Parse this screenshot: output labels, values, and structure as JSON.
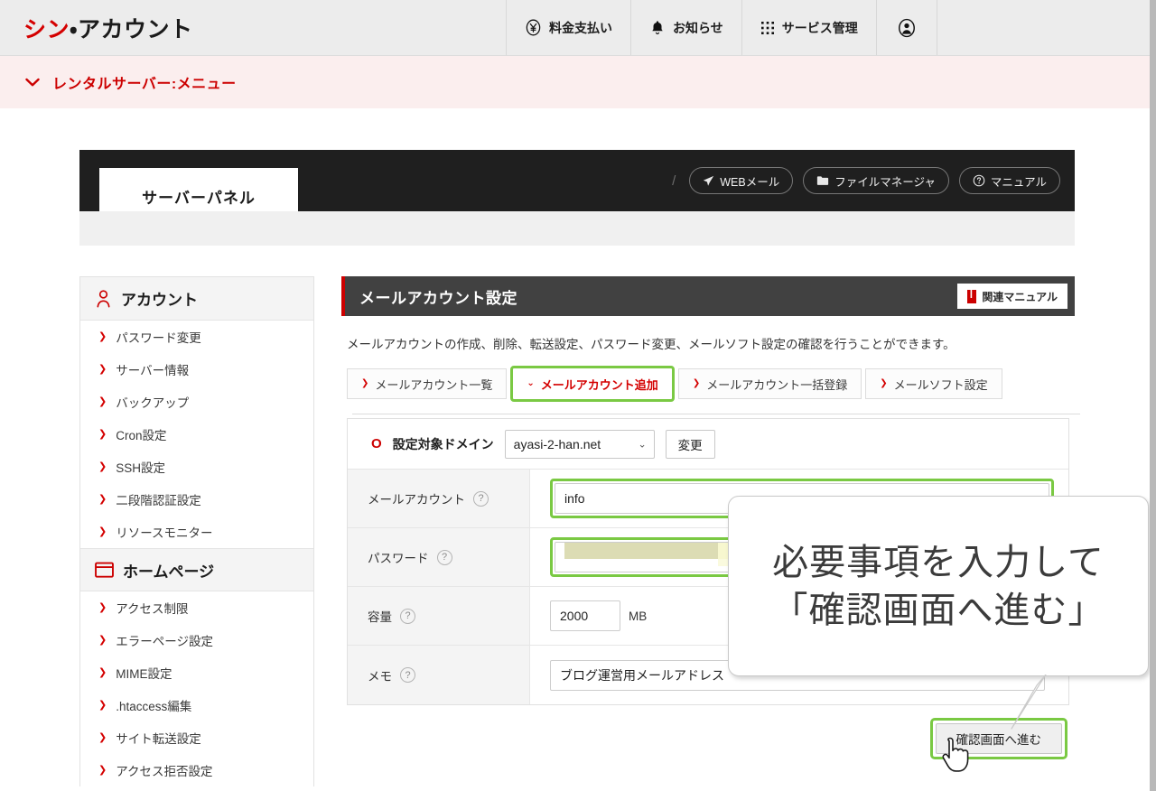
{
  "header": {
    "brand_red": "シン",
    "brand_dark": "・アカウント",
    "nav": [
      {
        "label": "料金支払い",
        "icon": "yen-circle-icon"
      },
      {
        "label": "お知らせ",
        "icon": "bell-icon"
      },
      {
        "label": "サービス管理",
        "icon": "grid-apps-icon"
      }
    ],
    "account_icon": "user-circle-icon"
  },
  "menustrip": {
    "label": "レンタルサーバー:メニュー",
    "icon": "chevron-down-icon"
  },
  "panel": {
    "logo": "サーバーパネル",
    "separator": "/",
    "tools": [
      {
        "label": "WEBメール",
        "icon": "paper-plane-icon"
      },
      {
        "label": "ファイルマネージャ",
        "icon": "folder-icon"
      },
      {
        "label": "マニュアル",
        "icon": "question-circle-icon"
      }
    ]
  },
  "sidebar": {
    "sections": [
      {
        "title": "アカウント",
        "icon": "person-icon",
        "items": [
          "パスワード変更",
          "サーバー情報",
          "バックアップ",
          "Cron設定",
          "SSH設定",
          "二段階認証設定",
          "リソースモニター"
        ]
      },
      {
        "title": "ホームページ",
        "icon": "browser-window-icon",
        "items": [
          "アクセス制限",
          "エラーページ設定",
          "MIME設定",
          ".htaccess編集",
          "サイト転送設定",
          "アクセス拒否設定"
        ]
      }
    ]
  },
  "main": {
    "page_title": "メールアカウント設定",
    "manual_button": "関連マニュアル",
    "manual_icon": "red-book-icon",
    "lede": "メールアカウントの作成、削除、転送設定、パスワード変更、メールソフト設定の確認を行うことができます。",
    "tabs": [
      {
        "label": "メールアカウント一覧",
        "active": false
      },
      {
        "label": "メールアカウント追加",
        "active": true
      },
      {
        "label": "メールアカウント一括登録",
        "active": false
      },
      {
        "label": "メールソフト設定",
        "active": false
      }
    ],
    "form": {
      "domain_row": {
        "label": "設定対象ドメイン",
        "selected": "ayasi-2-han.net",
        "change_button": "変更",
        "marker": "O"
      },
      "rows": [
        {
          "label": "メールアカウント",
          "value": "info",
          "help": "?",
          "highlight": true
        },
        {
          "label": "パスワード",
          "value": "",
          "help": "?",
          "highlight": true,
          "redacted": true
        },
        {
          "label": "容量",
          "value": "2000",
          "unit": "MB",
          "help": "?",
          "highlight": false
        },
        {
          "label": "メモ",
          "value": "ブログ運営用メールアドレス",
          "help": "?",
          "highlight": false
        }
      ],
      "submit_label": "確認画面へ進む"
    }
  },
  "callout": {
    "line1": "必要事項を入力して",
    "line2": "「確認画面へ進む」"
  },
  "colors": {
    "brand_red": "#d40000",
    "menu_strip_bg": "#fbeeee",
    "panel_dark": "#1f1f1f",
    "title_bar": "#414141",
    "highlight_green": "#7ac943",
    "redact_yellow": "#f7f7cf"
  }
}
